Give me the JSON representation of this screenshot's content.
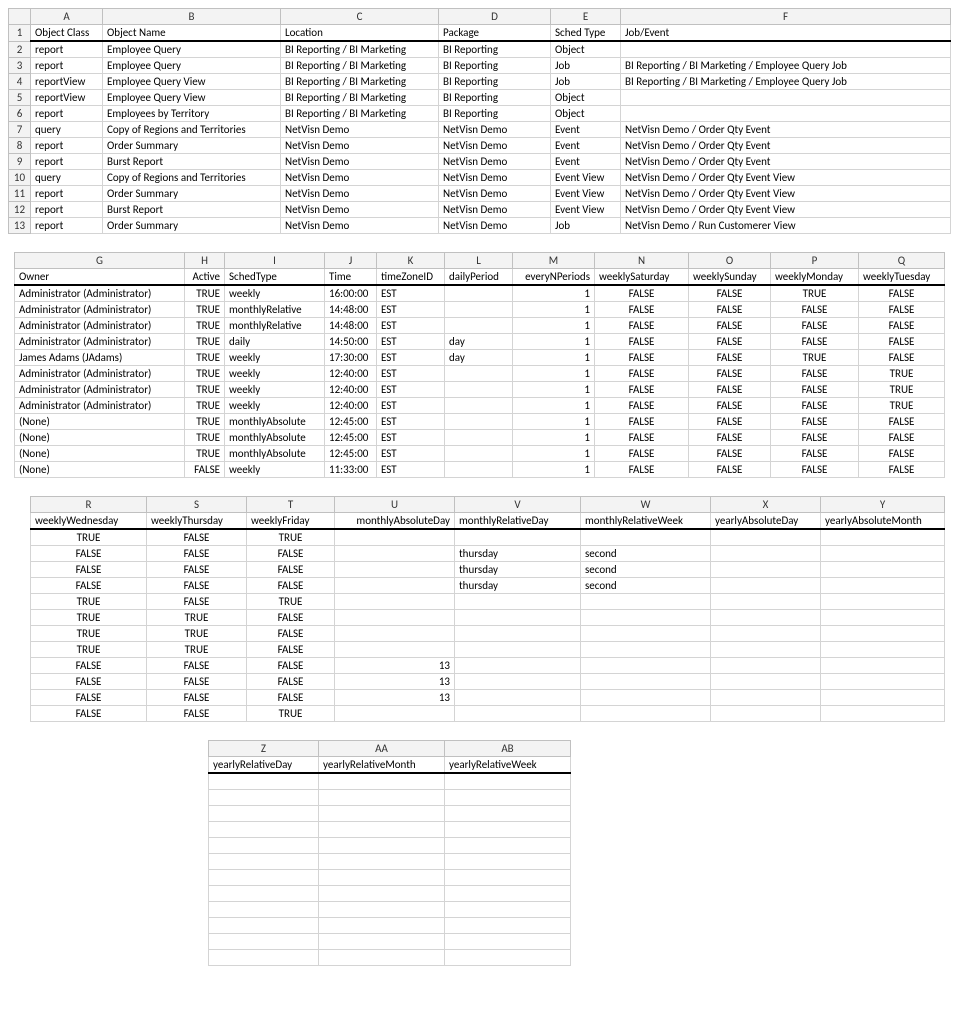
{
  "table1": {
    "cols": [
      "",
      "A",
      "B",
      "C",
      "D",
      "E",
      "F"
    ],
    "widths": [
      22,
      72,
      178,
      158,
      112,
      70,
      330
    ],
    "headers": [
      "Object Class",
      "Object Name",
      "Location",
      "Package",
      "Sched Type",
      "Job/Event"
    ],
    "rows": [
      [
        "2",
        "report",
        "Employee Query",
        "BI Reporting / BI Marketing",
        "BI Reporting",
        "Object",
        ""
      ],
      [
        "3",
        "report",
        "Employee Query",
        "BI Reporting / BI Marketing",
        "BI Reporting",
        "Job",
        "BI Reporting / BI Marketing / Employee Query Job"
      ],
      [
        "4",
        "reportView",
        "Employee Query View",
        "BI Reporting / BI Marketing",
        "BI Reporting",
        "Job",
        "BI Reporting / BI Marketing / Employee Query Job"
      ],
      [
        "5",
        "reportView",
        "Employee Query View",
        "BI Reporting / BI Marketing",
        "BI Reporting",
        "Object",
        ""
      ],
      [
        "6",
        "report",
        "Employees by Territory",
        "BI Reporting / BI Marketing",
        "BI Reporting",
        "Object",
        ""
      ],
      [
        "7",
        "query",
        "Copy of Regions and Territories",
        "NetVisn Demo",
        "NetVisn Demo",
        "Event",
        "NetVisn Demo / Order Qty Event"
      ],
      [
        "8",
        "report",
        "Order Summary",
        "NetVisn Demo",
        "NetVisn Demo",
        "Event",
        "NetVisn Demo / Order Qty Event"
      ],
      [
        "9",
        "report",
        "Burst Report",
        "NetVisn Demo",
        "NetVisn Demo",
        "Event",
        "NetVisn Demo / Order Qty Event"
      ],
      [
        "10",
        "query",
        "Copy of Regions and Territories",
        "NetVisn Demo",
        "NetVisn Demo",
        "Event View",
        "NetVisn Demo / Order Qty Event View"
      ],
      [
        "11",
        "report",
        "Order Summary",
        "NetVisn Demo",
        "NetVisn Demo",
        "Event View",
        "NetVisn Demo / Order Qty Event View"
      ],
      [
        "12",
        "report",
        "Burst Report",
        "NetVisn Demo",
        "NetVisn Demo",
        "Event View",
        "NetVisn Demo / Order Qty Event View"
      ],
      [
        "13",
        "report",
        "Order Summary",
        "NetVisn Demo",
        "NetVisn Demo",
        "Job",
        "NetVisn Demo / Run Customerer View"
      ]
    ]
  },
  "table2": {
    "cols": [
      "G",
      "H",
      "I",
      "J",
      "K",
      "L",
      "M",
      "N",
      "O",
      "P",
      "Q"
    ],
    "widths": [
      170,
      40,
      100,
      52,
      68,
      68,
      82,
      94,
      82,
      88,
      86
    ],
    "headers": [
      "Owner",
      "Active",
      "SchedType",
      "Time",
      "timeZoneID",
      "dailyPeriod",
      "everyNPeriods",
      "weeklySaturday",
      "weeklySunday",
      "weeklyMonday",
      "weeklyTuesday"
    ],
    "align": [
      "left",
      "right",
      "left",
      "left",
      "left",
      "left",
      "right",
      "center",
      "center",
      "center",
      "center"
    ],
    "rows": [
      [
        "Administrator (Administrator)",
        "TRUE",
        "weekly",
        "16:00:00",
        "EST",
        "",
        "1",
        "FALSE",
        "FALSE",
        "TRUE",
        "FALSE"
      ],
      [
        "Administrator (Administrator)",
        "TRUE",
        "monthlyRelative",
        "14:48:00",
        "EST",
        "",
        "1",
        "FALSE",
        "FALSE",
        "FALSE",
        "FALSE"
      ],
      [
        "Administrator (Administrator)",
        "TRUE",
        "monthlyRelative",
        "14:48:00",
        "EST",
        "",
        "1",
        "FALSE",
        "FALSE",
        "FALSE",
        "FALSE"
      ],
      [
        "Administrator (Administrator)",
        "TRUE",
        "daily",
        "14:50:00",
        "EST",
        "day",
        "1",
        "FALSE",
        "FALSE",
        "FALSE",
        "FALSE"
      ],
      [
        "James Adams (JAdams)",
        "TRUE",
        "weekly",
        "17:30:00",
        "EST",
        "day",
        "1",
        "FALSE",
        "FALSE",
        "TRUE",
        "FALSE"
      ],
      [
        "Administrator (Administrator)",
        "TRUE",
        "weekly",
        "12:40:00",
        "EST",
        "",
        "1",
        "FALSE",
        "FALSE",
        "FALSE",
        "TRUE"
      ],
      [
        "Administrator (Administrator)",
        "TRUE",
        "weekly",
        "12:40:00",
        "EST",
        "",
        "1",
        "FALSE",
        "FALSE",
        "FALSE",
        "TRUE"
      ],
      [
        "Administrator (Administrator)",
        "TRUE",
        "weekly",
        "12:40:00",
        "EST",
        "",
        "1",
        "FALSE",
        "FALSE",
        "FALSE",
        "TRUE"
      ],
      [
        "(None)",
        "TRUE",
        "monthlyAbsolute",
        "12:45:00",
        "EST",
        "",
        "1",
        "FALSE",
        "FALSE",
        "FALSE",
        "FALSE"
      ],
      [
        "(None)",
        "TRUE",
        "monthlyAbsolute",
        "12:45:00",
        "EST",
        "",
        "1",
        "FALSE",
        "FALSE",
        "FALSE",
        "FALSE"
      ],
      [
        "(None)",
        "TRUE",
        "monthlyAbsolute",
        "12:45:00",
        "EST",
        "",
        "1",
        "FALSE",
        "FALSE",
        "FALSE",
        "FALSE"
      ],
      [
        "(None)",
        "FALSE",
        "weekly",
        "11:33:00",
        "EST",
        "",
        "1",
        "FALSE",
        "FALSE",
        "FALSE",
        "FALSE"
      ]
    ]
  },
  "table3": {
    "cols": [
      "R",
      "S",
      "T",
      "U",
      "V",
      "W",
      "X",
      "Y"
    ],
    "widths": [
      116,
      100,
      88,
      120,
      126,
      130,
      110,
      124
    ],
    "headers": [
      "weeklyWednesday",
      "weeklyThursday",
      "weeklyFriday",
      "monthlyAbsoluteDay",
      "monthlyRelativeDay",
      "monthlyRelativeWeek",
      "yearlyAbsoluteDay",
      "yearlyAbsoluteMonth"
    ],
    "align": [
      "center",
      "center",
      "center",
      "right",
      "left",
      "left",
      "left",
      "left"
    ],
    "rows": [
      [
        "TRUE",
        "FALSE",
        "TRUE",
        "",
        "",
        "",
        "",
        ""
      ],
      [
        "FALSE",
        "FALSE",
        "FALSE",
        "",
        "thursday",
        "second",
        "",
        ""
      ],
      [
        "FALSE",
        "FALSE",
        "FALSE",
        "",
        "thursday",
        "second",
        "",
        ""
      ],
      [
        "FALSE",
        "FALSE",
        "FALSE",
        "",
        "thursday",
        "second",
        "",
        ""
      ],
      [
        "TRUE",
        "FALSE",
        "TRUE",
        "",
        "",
        "",
        "",
        ""
      ],
      [
        "TRUE",
        "TRUE",
        "FALSE",
        "",
        "",
        "",
        "",
        ""
      ],
      [
        "TRUE",
        "TRUE",
        "FALSE",
        "",
        "",
        "",
        "",
        ""
      ],
      [
        "TRUE",
        "TRUE",
        "FALSE",
        "",
        "",
        "",
        "",
        ""
      ],
      [
        "FALSE",
        "FALSE",
        "FALSE",
        "13",
        "",
        "",
        "",
        ""
      ],
      [
        "FALSE",
        "FALSE",
        "FALSE",
        "13",
        "",
        "",
        "",
        ""
      ],
      [
        "FALSE",
        "FALSE",
        "FALSE",
        "13",
        "",
        "",
        "",
        ""
      ],
      [
        "FALSE",
        "FALSE",
        "TRUE",
        "",
        "",
        "",
        "",
        ""
      ]
    ]
  },
  "table4": {
    "cols": [
      "Z",
      "AA",
      "AB"
    ],
    "widths": [
      110,
      126,
      126
    ],
    "headers": [
      "yearlyRelativeDay",
      "yearlyRelativeMonth",
      "yearlyRelativeWeek"
    ],
    "align": [
      "left",
      "left",
      "left"
    ],
    "rows": [
      [
        "",
        "",
        ""
      ],
      [
        "",
        "",
        ""
      ],
      [
        "",
        "",
        ""
      ],
      [
        "",
        "",
        ""
      ],
      [
        "",
        "",
        ""
      ],
      [
        "",
        "",
        ""
      ],
      [
        "",
        "",
        ""
      ],
      [
        "",
        "",
        ""
      ],
      [
        "",
        "",
        ""
      ],
      [
        "",
        "",
        ""
      ],
      [
        "",
        "",
        ""
      ],
      [
        "",
        "",
        ""
      ]
    ]
  }
}
